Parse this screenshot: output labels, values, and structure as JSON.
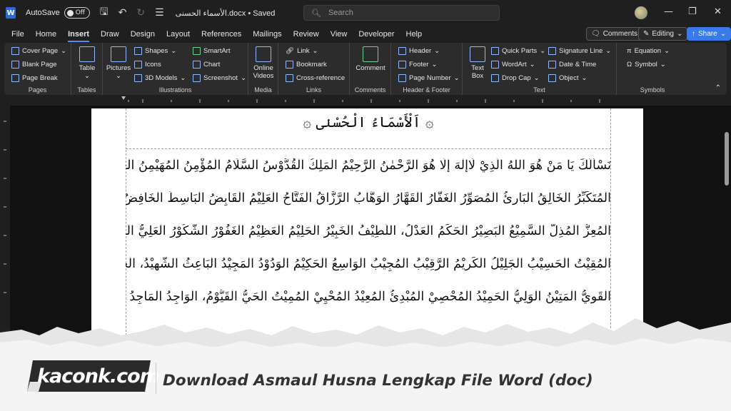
{
  "titlebar": {
    "app_icon": "W",
    "autosave_label": "AutoSave",
    "autosave_state": "Off",
    "doc_title": "الأسماء الحسنى.docx • Saved",
    "search_placeholder": "Search"
  },
  "menubar": {
    "tabs": [
      "File",
      "Home",
      "Insert",
      "Draw",
      "Design",
      "Layout",
      "References",
      "Mailings",
      "Review",
      "View",
      "Developer",
      "Help"
    ],
    "active_tab": "Insert",
    "comments_label": "Comments",
    "editing_label": "Editing",
    "share_label": "Share"
  },
  "ribbon": {
    "pages": {
      "label": "Pages",
      "items": [
        "Cover Page",
        "Blank Page",
        "Page Break"
      ]
    },
    "tables": {
      "label": "Tables",
      "items": [
        "Table"
      ]
    },
    "illustrations": {
      "label": "Illustrations",
      "items": [
        "Pictures",
        "Shapes",
        "Icons",
        "3D Models",
        "SmartArt",
        "Chart",
        "Screenshot"
      ]
    },
    "media": {
      "label": "Media",
      "items": [
        "Online",
        "Videos"
      ]
    },
    "links": {
      "label": "Links",
      "items": [
        "Link",
        "Bookmark",
        "Cross-reference"
      ]
    },
    "comments": {
      "label": "Comments",
      "items": [
        "Comment"
      ]
    },
    "header_footer": {
      "label": "Header & Footer",
      "items": [
        "Header",
        "Footer",
        "Page Number"
      ]
    },
    "text": {
      "label": "Text",
      "items": [
        "Text",
        "Box",
        "Quick Parts",
        "WordArt",
        "Drop Cap",
        "Signature Line",
        "Date & Time",
        "Object"
      ]
    },
    "symbols": {
      "label": "Symbols",
      "items": [
        "Equation",
        "Symbol"
      ]
    }
  },
  "document": {
    "heading": "۞ اَلْأَسْمَاءُ الْحُسْنٰى ۞",
    "lines": [
      "نَسْأَلُكَ يَا مَنْ هُوَ اللهُ الَّذِيْ لَاإِلٰهَ إِلَّا هُوَ الرَّحْمٰنُ الرَّحِيْمُ الْمَلِكُ الْقُدُّوْسُ السَّلَامُ الْمُؤْمِنُ الْمُهَيْمِنُ الْعَزِيْزُ الْجَبَّارُ،",
      "الْمُتَكَبِّرُ الْخَالِقُ الْبَارِئُ الْمُصَوِّرُ الْغَفَّارُ الْقَهَّارُ الْوَهَّابُ الرَّزَّاقُ الْفَتَّاحُ الْعَلِيْمُ الْقَابِضُ الْبَاسِطُ الْخَافِضُ الرَّافِعُ",
      "الْمُعِزُّ الْمُذِلُّ السَّمِيْعُ الْبَصِيْرُ الْحَكَمُ الْعَدْلُ، اللَّطِيْفُ الْخَبِيْرُ الْحَلِيْمُ الْعَظِيْمُ الْغَفُوْرُ الشَّكُوْرُ الْعَلِيُّ الْكَبِيْرُ الْحَفِيْظُ",
      "الْمُقِيْتُ الْحَسِيْبُ الْجَلِيْلُ الْكَرِيْمُ الرَّقِيْبُ الْمُجِيْبُ الْوَاسِعُ الْحَكِيْمُ الْوَدُوْدُ الْمَجِيْدُ الْبَاعِثُ الشَّهِيْدُ، الْحَقُّ الْوَكِيْلُ",
      "الْقَوِيُّ الْمَتِيْنُ الْوَلِيُّ الْحَمِيْدُ الْمُحْصِيْ الْمُبْدِئُ الْمُعِيْدُ الْمُحْيِيْ الْمُمِيْتُ الْحَيُّ الْقَيُّوْمُ، الْوَاجِدُ الْمَاجِدُ الْوَاحِدُ الصَّمَدُ"
    ]
  },
  "banner": {
    "logo_main": "kaconk",
    "logo_suffix": ".com",
    "caption": "Download Asmaul Husna Lengkap File Word (doc)"
  }
}
